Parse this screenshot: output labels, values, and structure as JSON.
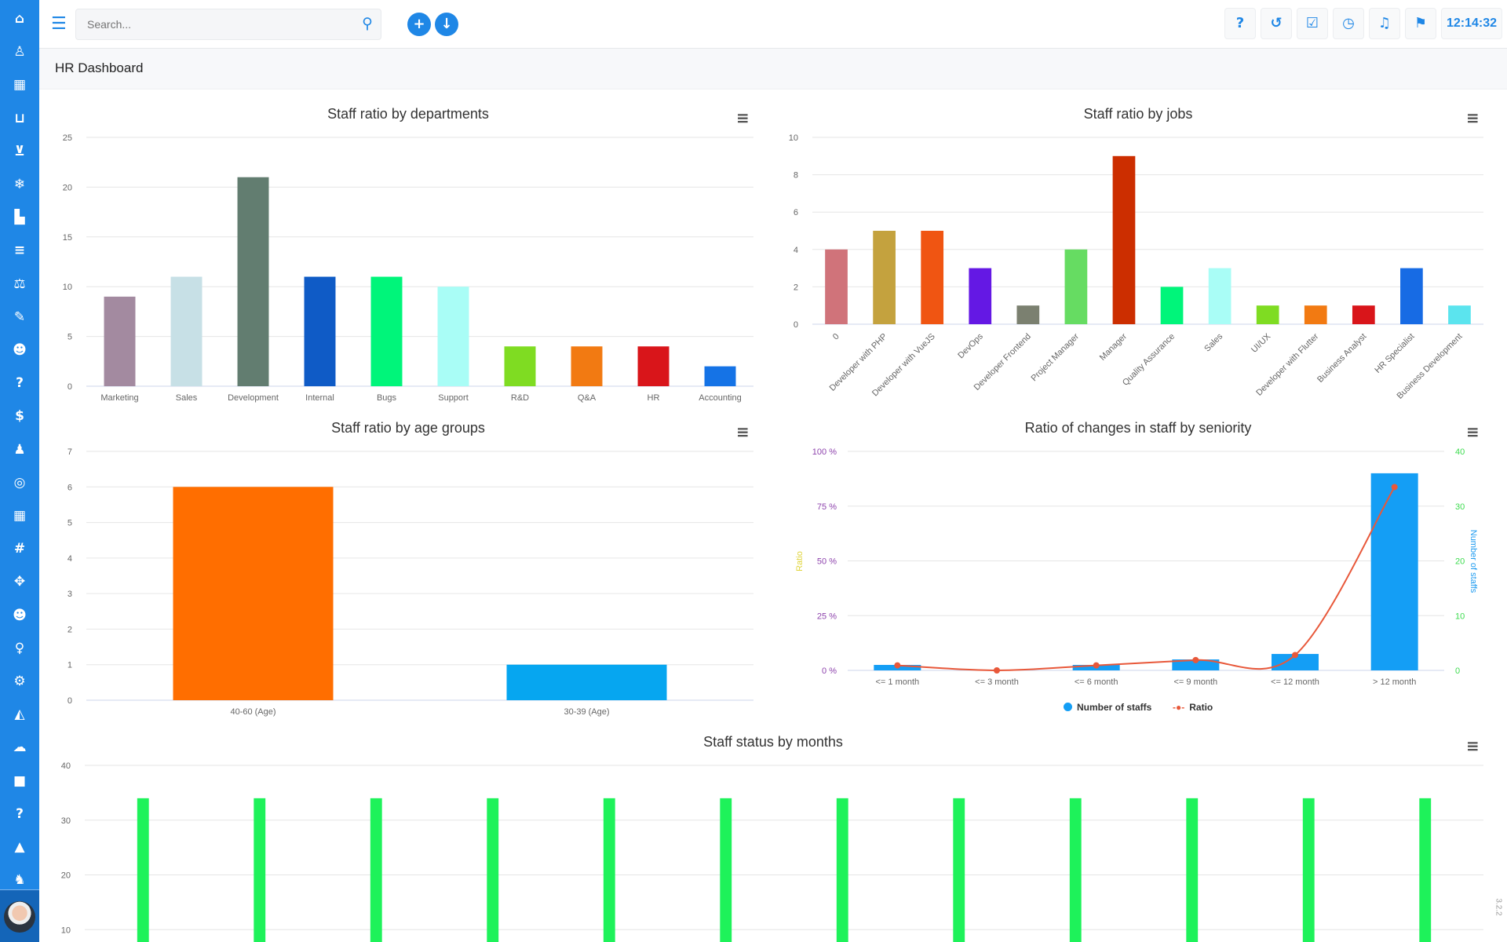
{
  "sidebar": {
    "icons": [
      "home-icon",
      "user-icon",
      "table-icon",
      "basket-icon",
      "cart-icon",
      "snowflake-icon",
      "factory-icon",
      "list-icon",
      "balance-scale-icon",
      "ticket-icon",
      "user-circle-icon",
      "question-icon",
      "dollar-icon",
      "users-icon",
      "bullseye-icon",
      "calendar-icon",
      "hashtag-icon",
      "crosshairs-icon",
      "user-circle-icon",
      "lightbulb-icon",
      "cogs-icon",
      "area-chart-icon",
      "cloud-upload-icon",
      "video-icon",
      "question-icon",
      "lock-icon",
      "android-icon"
    ],
    "glyphs": [
      "⌂",
      "♙",
      "▦",
      "⊔",
      "⊻",
      "❄",
      "▙",
      "≡",
      "⚖",
      "✎",
      "☻",
      "?",
      "$",
      "♟",
      "◎",
      "▦",
      "#",
      "✥",
      "☻",
      "♀",
      "⚙",
      "◭",
      "☁",
      "■",
      "?",
      "▲",
      "♞"
    ]
  },
  "topbar": {
    "search_placeholder": "Search...",
    "clock": "12:14:32"
  },
  "page": {
    "title": "HR Dashboard",
    "version": "3.2.2"
  },
  "colors": {
    "accent": "#1f87e6"
  },
  "chart_data": [
    {
      "type": "bar",
      "title": "Staff ratio by departments",
      "ylim": [
        0,
        25
      ],
      "yticks": [
        0,
        5,
        10,
        15,
        20,
        25
      ],
      "grid": true,
      "categories": [
        "Marketing",
        "Sales",
        "Development",
        "Internal",
        "Bugs",
        "Support",
        "R&D",
        "Q&A",
        "HR",
        "Accounting"
      ],
      "values": [
        9,
        11,
        21,
        11,
        11,
        10,
        4,
        4,
        4,
        2
      ],
      "colors": [
        "#a38aa0",
        "#c7e0e6",
        "#627d70",
        "#0f5bc6",
        "#00f57a",
        "#a9fdf6",
        "#7fdc22",
        "#f27a12",
        "#d9151a",
        "#1573e6"
      ]
    },
    {
      "type": "bar",
      "title": "Staff ratio by jobs",
      "ylim": [
        0,
        10
      ],
      "yticks": [
        0,
        2,
        4,
        6,
        8,
        10
      ],
      "grid": true,
      "categories": [
        "0",
        "Developer with PHP",
        "Developer with VueJS",
        "DevOps",
        "Developer Frontend",
        "Project Manager",
        "Manager",
        "Quality Assurance",
        "Sales",
        "UI/UX",
        "Developer with Flutter",
        "Business Analyst",
        "HR Specialist",
        "Business Development"
      ],
      "values": [
        4,
        5,
        5,
        3,
        1,
        4,
        9,
        2,
        3,
        1,
        1,
        1,
        3,
        1
      ],
      "colors": [
        "#d0737a",
        "#c4a23e",
        "#f05512",
        "#6418e4",
        "#7b8070",
        "#66dc62",
        "#cc2e00",
        "#00f57a",
        "#a9fdf6",
        "#7fdc22",
        "#f27a12",
        "#d9151a",
        "#176be4",
        "#5be4ee"
      ]
    },
    {
      "type": "bar",
      "title": "Staff ratio by age groups",
      "ylim": [
        0,
        7
      ],
      "yticks": [
        0,
        1,
        2,
        3,
        4,
        5,
        6,
        7
      ],
      "grid": true,
      "categories": [
        "40-60 (Age)",
        "30-39 (Age)"
      ],
      "values": [
        6,
        1
      ],
      "colors": [
        "#ff6e00",
        "#06a6f0"
      ]
    },
    {
      "type": "bar+line",
      "title": "Ratio of changes in staff by seniority",
      "grid": true,
      "legend": "bottom",
      "categories": [
        "<= 1 month",
        "<= 3 month",
        "<= 6 month",
        "<= 9 month",
        "<= 12 month",
        "> 12 month"
      ],
      "y_left": {
        "label": "Ratio",
        "ylim": [
          0,
          100
        ],
        "ticks": [
          "0 %",
          "25 %",
          "50 %",
          "75 %",
          "100 %"
        ],
        "color": "#8e44ad",
        "label_color": "#e0d43a"
      },
      "y_right": {
        "label": "Number of staffs",
        "ylim": [
          0,
          40
        ],
        "ticks": [
          "0",
          "10",
          "20",
          "30",
          "40"
        ],
        "color": "#3ddc4f",
        "label_color": "#1e9bf0"
      },
      "series": [
        {
          "name": "Number of staffs",
          "type": "bar",
          "axis": "right",
          "values": [
            1,
            0,
            1,
            2,
            3,
            36
          ],
          "color": "#149ef5"
        },
        {
          "name": "Ratio",
          "type": "line",
          "axis": "left",
          "values": [
            2.3,
            0,
            2.3,
            4.7,
            7.0,
            83.7
          ],
          "color": "#e8583a"
        }
      ]
    },
    {
      "type": "bar",
      "title": "Staff status by months",
      "yticks": [
        10,
        20,
        30,
        40
      ],
      "ylim": [
        0,
        40
      ],
      "grid": true,
      "values": [
        34,
        34,
        34,
        34,
        34,
        34,
        34,
        34,
        34,
        34,
        34,
        34
      ],
      "colors": [
        "#1ef25a"
      ]
    }
  ]
}
